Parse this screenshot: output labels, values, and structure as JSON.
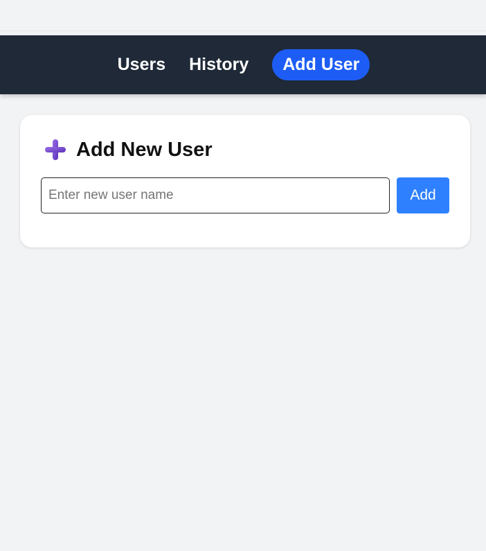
{
  "nav": {
    "items": [
      {
        "label": "Users",
        "active": false
      },
      {
        "label": "History",
        "active": false
      },
      {
        "label": "Add User",
        "active": true
      }
    ],
    "background_color": "#1f2937",
    "active_color": "#1d5df5"
  },
  "add_user_card": {
    "icon": "plus-icon",
    "icon_color": "#7b4fd0",
    "title": "Add New User",
    "input": {
      "value": "",
      "placeholder": "Enter new user name"
    },
    "button_label": "Add",
    "button_color": "#2f80ff"
  }
}
